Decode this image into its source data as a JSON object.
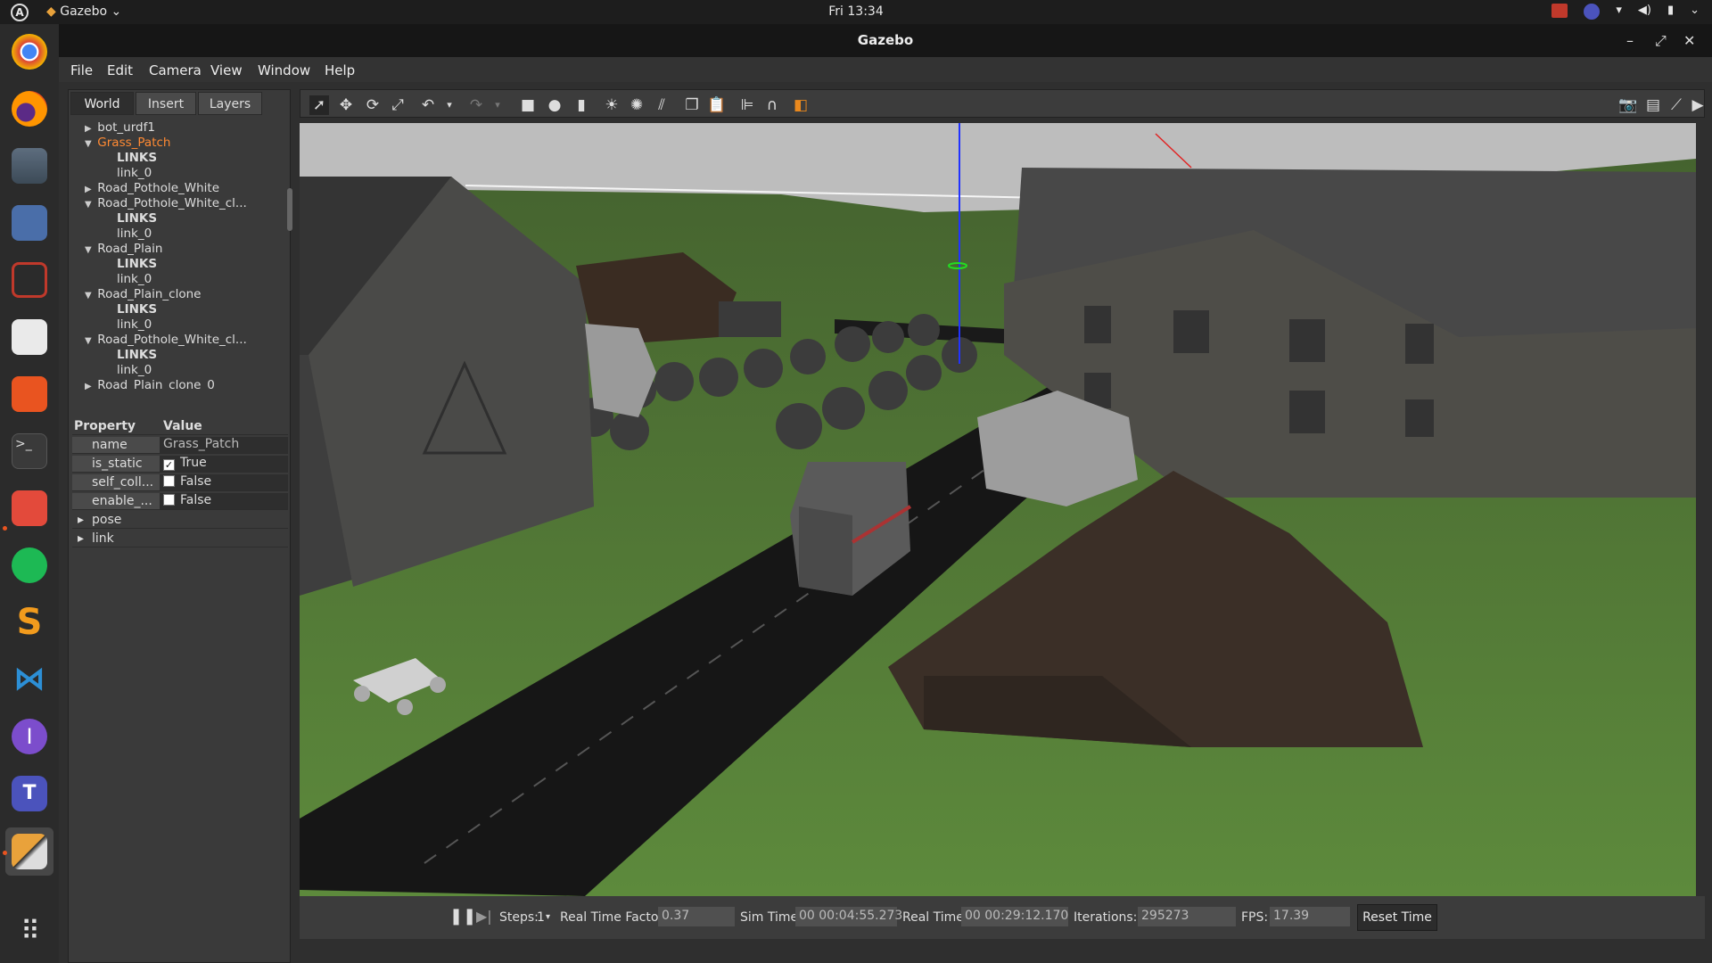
{
  "topbar": {
    "activities_glyph": "A",
    "app_name": "Gazebo",
    "clock": "Fri 13:34",
    "tray_icons": [
      "record-icon",
      "teams-icon",
      "network-icon",
      "volume-icon",
      "battery-icon",
      "chevron-down-icon"
    ]
  },
  "dock": {
    "apps": [
      "chrome",
      "firefox",
      "files",
      "screenshot",
      "recorder",
      "text-editor",
      "app-store",
      "terminal",
      "anydesk",
      "spotify",
      "sublime-text",
      "vscode",
      "intellij",
      "teams",
      "gazebo",
      "show-applications"
    ]
  },
  "window": {
    "title": "Gazebo",
    "menu": [
      "File",
      "Edit",
      "Camera",
      "View",
      "Window",
      "Help"
    ]
  },
  "left_panel": {
    "tabs": [
      "World",
      "Insert",
      "Layers"
    ],
    "active_tab": "World",
    "tree": [
      {
        "label": "bot_urdf1",
        "arrow": "▶"
      },
      {
        "label": "Grass_Patch",
        "arrow": "▼"
      },
      {
        "label": "LINKS",
        "arrow": ""
      },
      {
        "label": "link_0",
        "arrow": ""
      },
      {
        "label": "Road_Pothole_White",
        "arrow": "▶"
      },
      {
        "label": "Road_Pothole_White_cl...",
        "arrow": "▼"
      },
      {
        "label": "LINKS",
        "arrow": ""
      },
      {
        "label": "link_0",
        "arrow": ""
      },
      {
        "label": "Road_Plain",
        "arrow": "▼"
      },
      {
        "label": "LINKS",
        "arrow": ""
      },
      {
        "label": "link_0",
        "arrow": ""
      },
      {
        "label": "Road_Plain_clone",
        "arrow": "▼"
      },
      {
        "label": "LINKS",
        "arrow": ""
      },
      {
        "label": "link_0",
        "arrow": ""
      },
      {
        "label": "Road_Pothole_White_cl...",
        "arrow": "▼"
      },
      {
        "label": "LINKS",
        "arrow": ""
      },
      {
        "label": "link_0",
        "arrow": ""
      },
      {
        "label": "Road_Plain_clone_0",
        "arrow": "▶"
      }
    ],
    "props_header": {
      "property": "Property",
      "value": "Value"
    },
    "props": [
      {
        "key": "name",
        "value": "Grass_Patch",
        "checkbox": null
      },
      {
        "key": "is_static",
        "value": "True",
        "checkbox": true
      },
      {
        "key": "self_coll...",
        "value": "False",
        "checkbox": false
      },
      {
        "key": "enable_...",
        "value": "False",
        "checkbox": false
      }
    ],
    "expandables": [
      "pose",
      "link"
    ]
  },
  "toolbar": {
    "left_tools": [
      "select-arrow-icon",
      "translate-icon",
      "rotate-icon",
      "scale-icon",
      "undo-icon",
      "undo-dropdown-icon",
      "redo-icon",
      "redo-dropdown-icon",
      "box-shape-icon",
      "sphere-shape-icon",
      "cylinder-shape-icon",
      "point-light-icon",
      "spot-light-icon",
      "directional-light-icon",
      "copy-icon",
      "paste-icon",
      "align-icon",
      "snap-icon",
      "view-angle-icon"
    ],
    "right_tools": [
      "screenshot-icon",
      "log-icon",
      "plot-icon",
      "video-record-icon"
    ]
  },
  "bottom": {
    "steps_label": "Steps:",
    "steps_value": "1",
    "rtf_label": "Real Time Factor:",
    "rtf_value": "0.37",
    "sim_label": "Sim Time:",
    "sim_value": "00 00:04:55.273",
    "real_label": "Real Time:",
    "real_value": "00 00:29:12.170",
    "iter_label": "Iterations:",
    "iter_value": "295273",
    "fps_label": "FPS:",
    "fps_value": "17.39",
    "reset_label": "Reset Time"
  },
  "colors": {
    "selected_tree_item": "#ff8a33",
    "accent_orange": "#e95420",
    "grass": "#4f7a2f",
    "sky": "#bdbdbd"
  }
}
